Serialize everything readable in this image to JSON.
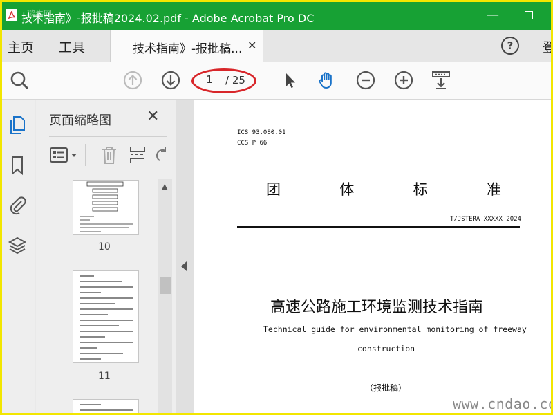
{
  "window": {
    "title": "技术指南》-报批稿2024.02.pdf - Adobe Acrobat Pro DC",
    "watermark": "鹅牛网"
  },
  "menu": {
    "home": "主页",
    "tools": "工具",
    "doc_tab": "技术指南》-报批稿...",
    "login_partial": "登"
  },
  "toolbar": {
    "page_current": "1",
    "page_total": "/ 25"
  },
  "thumbnails": {
    "title": "页面缩略图",
    "pages": [
      {
        "number": "10"
      },
      {
        "number": "11"
      }
    ]
  },
  "document": {
    "ics": "ICS 93.080.01",
    "ccs": "CCS P 66",
    "standard_type_chars": [
      "团",
      "体",
      "标",
      "准"
    ],
    "standard_no": "T/JSTERA XXXXX—2024",
    "title_zh": "高速公路施工环境监测技术指南",
    "title_en_line1": "Technical guide for environmental monitoring of freeway",
    "title_en_line2": "construction",
    "draft_label": "（报批稿）"
  },
  "site_watermark": "www.cndao.com",
  "colors": {
    "titlebar": "#17a134",
    "frame_border": "#f2e600",
    "annotation_circle": "#d8262a",
    "icon_blue": "#1a73c9"
  }
}
